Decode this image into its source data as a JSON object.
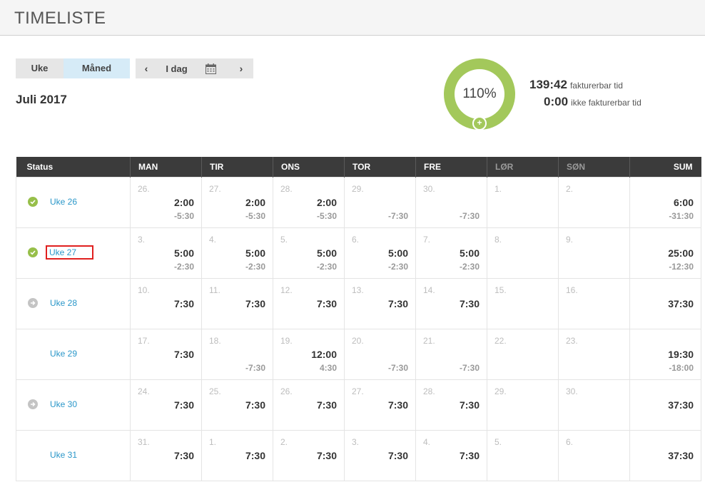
{
  "header": {
    "title": "TIMELISTE"
  },
  "view_toggle": {
    "week_label": "Uke",
    "month_label": "Måned",
    "active": "Måned"
  },
  "date_nav": {
    "prev": "‹",
    "today": "I dag",
    "next": "›"
  },
  "month_title": "Juli 2017",
  "summary": {
    "percent": "110%",
    "billable_time": "139:42",
    "billable_label": "fakturerbar tid",
    "nonbillable_time": "0:00",
    "nonbillable_label": "ikke fakturerbar tid",
    "accent_color": "#a3c85b"
  },
  "table": {
    "headers": [
      "Status",
      "MAN",
      "TIR",
      "ONS",
      "TOR",
      "FRE",
      "LØR",
      "SØN",
      "SUM"
    ],
    "rows": [
      {
        "status": "approved",
        "week": "Uke 26",
        "days": [
          {
            "num": "26.",
            "hours": "2:00",
            "diff": "-5:30"
          },
          {
            "num": "27.",
            "hours": "2:00",
            "diff": "-5:30"
          },
          {
            "num": "28.",
            "hours": "2:00",
            "diff": "-5:30"
          },
          {
            "num": "29.",
            "hours": "",
            "diff": "-7:30"
          },
          {
            "num": "30.",
            "hours": "",
            "diff": "-7:30"
          },
          {
            "num": "1.",
            "hours": "",
            "diff": ""
          },
          {
            "num": "2.",
            "hours": "",
            "diff": ""
          }
        ],
        "sum": {
          "hours": "6:00",
          "diff": "-31:30"
        }
      },
      {
        "status": "approved",
        "week": "Uke 27",
        "days": [
          {
            "num": "3.",
            "hours": "5:00",
            "diff": "-2:30"
          },
          {
            "num": "4.",
            "hours": "5:00",
            "diff": "-2:30"
          },
          {
            "num": "5.",
            "hours": "5:00",
            "diff": "-2:30"
          },
          {
            "num": "6.",
            "hours": "5:00",
            "diff": "-2:30"
          },
          {
            "num": "7.",
            "hours": "5:00",
            "diff": "-2:30"
          },
          {
            "num": "8.",
            "hours": "",
            "diff": ""
          },
          {
            "num": "9.",
            "hours": "",
            "diff": ""
          }
        ],
        "sum": {
          "hours": "25:00",
          "diff": "-12:30"
        }
      },
      {
        "status": "submit",
        "week": "Uke 28",
        "days": [
          {
            "num": "10.",
            "hours": "7:30",
            "diff": ""
          },
          {
            "num": "11.",
            "hours": "7:30",
            "diff": ""
          },
          {
            "num": "12.",
            "hours": "7:30",
            "diff": ""
          },
          {
            "num": "13.",
            "hours": "7:30",
            "diff": ""
          },
          {
            "num": "14.",
            "hours": "7:30",
            "diff": ""
          },
          {
            "num": "15.",
            "hours": "",
            "diff": ""
          },
          {
            "num": "16.",
            "hours": "",
            "diff": ""
          }
        ],
        "sum": {
          "hours": "37:30",
          "diff": ""
        }
      },
      {
        "status": "none",
        "week": "Uke 29",
        "days": [
          {
            "num": "17.",
            "hours": "7:30",
            "diff": ""
          },
          {
            "num": "18.",
            "hours": "",
            "diff": "-7:30"
          },
          {
            "num": "19.",
            "hours": "12:00",
            "diff": "4:30"
          },
          {
            "num": "20.",
            "hours": "",
            "diff": "-7:30"
          },
          {
            "num": "21.",
            "hours": "",
            "diff": "-7:30"
          },
          {
            "num": "22.",
            "hours": "",
            "diff": ""
          },
          {
            "num": "23.",
            "hours": "",
            "diff": ""
          }
        ],
        "sum": {
          "hours": "19:30",
          "diff": "-18:00"
        }
      },
      {
        "status": "submit",
        "week": "Uke 30",
        "days": [
          {
            "num": "24.",
            "hours": "7:30",
            "diff": ""
          },
          {
            "num": "25.",
            "hours": "7:30",
            "diff": ""
          },
          {
            "num": "26.",
            "hours": "7:30",
            "diff": ""
          },
          {
            "num": "27.",
            "hours": "7:30",
            "diff": ""
          },
          {
            "num": "28.",
            "hours": "7:30",
            "diff": ""
          },
          {
            "num": "29.",
            "hours": "",
            "diff": ""
          },
          {
            "num": "30.",
            "hours": "",
            "diff": ""
          }
        ],
        "sum": {
          "hours": "37:30",
          "diff": ""
        }
      },
      {
        "status": "none",
        "week": "Uke 31",
        "days": [
          {
            "num": "31.",
            "hours": "7:30",
            "diff": ""
          },
          {
            "num": "1.",
            "hours": "7:30",
            "diff": ""
          },
          {
            "num": "2.",
            "hours": "7:30",
            "diff": ""
          },
          {
            "num": "3.",
            "hours": "7:30",
            "diff": ""
          },
          {
            "num": "4.",
            "hours": "7:30",
            "diff": ""
          },
          {
            "num": "5.",
            "hours": "",
            "diff": ""
          },
          {
            "num": "6.",
            "hours": "",
            "diff": ""
          }
        ],
        "sum": {
          "hours": "37:30",
          "diff": ""
        }
      }
    ]
  }
}
